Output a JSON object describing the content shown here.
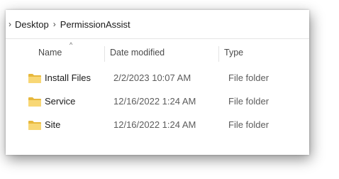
{
  "breadcrumb": {
    "separator": "›",
    "items": [
      "Desktop",
      "PermissionAssist"
    ]
  },
  "columns": {
    "name": "Name",
    "date": "Date modified",
    "type": "Type",
    "sort_indicator": "^"
  },
  "files": [
    {
      "name": "Install Files",
      "date": "2/2/2023 10:07 AM",
      "type": "File folder",
      "icon": "folder-icon"
    },
    {
      "name": "Service",
      "date": "12/16/2022 1:24 AM",
      "type": "File folder",
      "icon": "folder-icon"
    },
    {
      "name": "Site",
      "date": "12/16/2022 1:24 AM",
      "type": "File folder",
      "icon": "folder-icon"
    }
  ],
  "colors": {
    "folder": "#f8d775",
    "folder_dark": "#e7b83c",
    "window_bg": "#ffffff"
  }
}
